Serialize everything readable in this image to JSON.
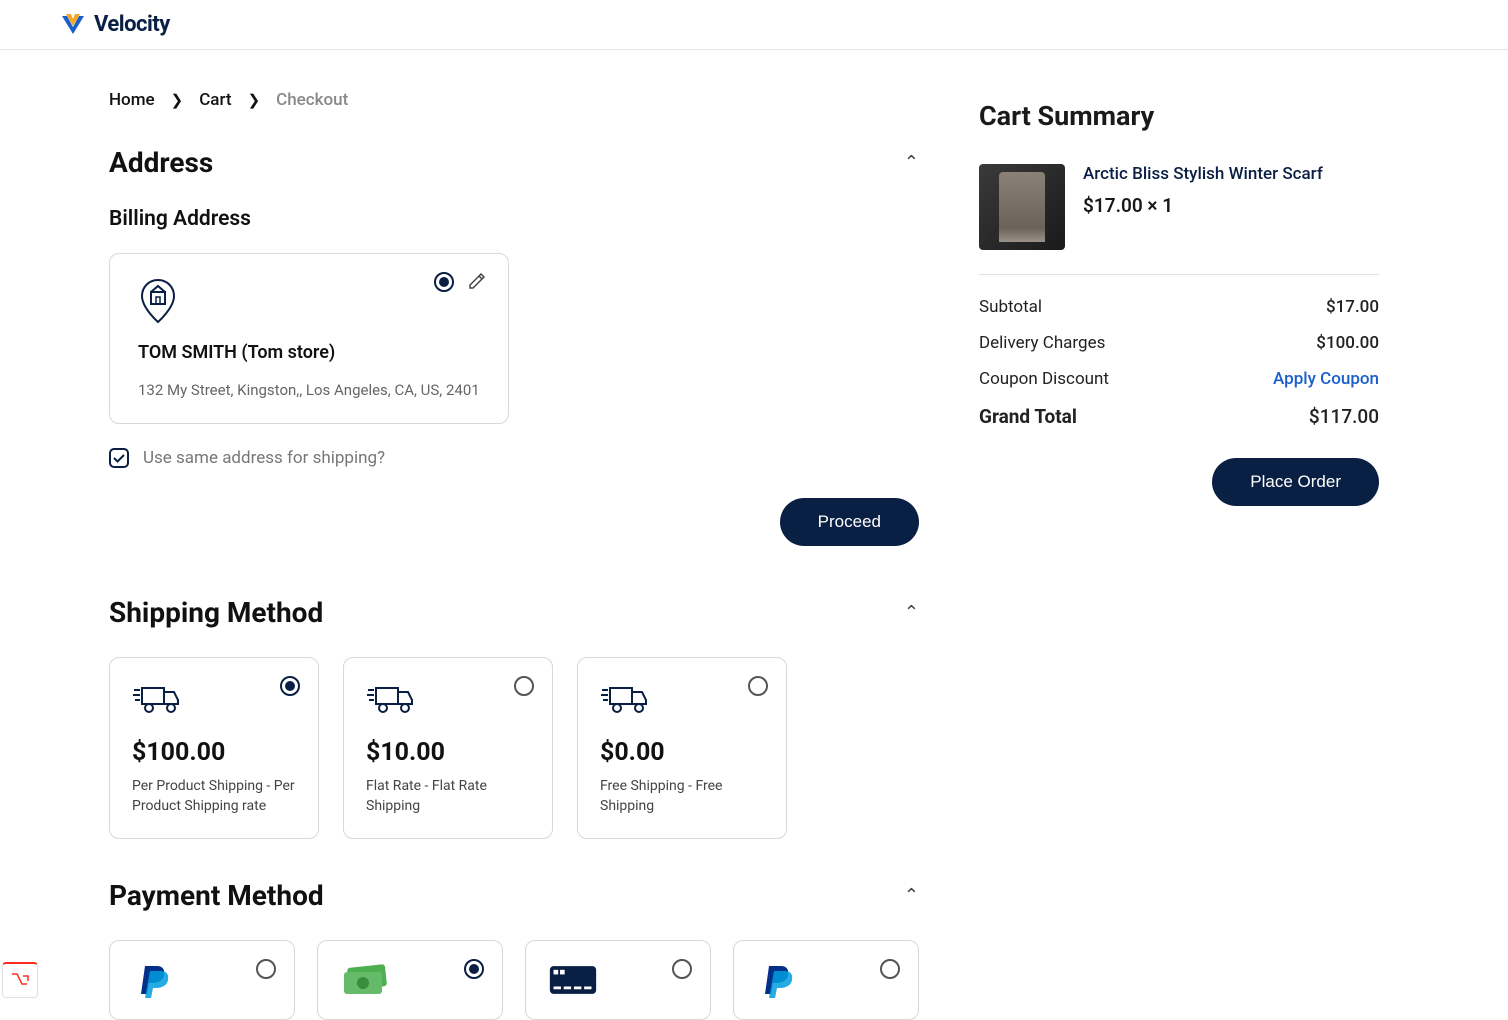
{
  "brand": {
    "name": "Velocity"
  },
  "breadcrumb": {
    "home": "Home",
    "cart": "Cart",
    "checkout": "Checkout"
  },
  "address": {
    "section_title": "Address",
    "billing_title": "Billing Address",
    "name": "TOM SMITH (Tom store)",
    "line": "132 My Street, Kingston,, Los Angeles, CA, US, 2401",
    "same_shipping_label": "Use same address for shipping?",
    "proceed_label": "Proceed"
  },
  "shipping": {
    "section_title": "Shipping Method",
    "options": [
      {
        "price": "$100.00",
        "desc": "Per Product Shipping - Per Product Shipping rate",
        "selected": true
      },
      {
        "price": "$10.00",
        "desc": "Flat Rate - Flat Rate Shipping",
        "selected": false
      },
      {
        "price": "$0.00",
        "desc": "Free Shipping - Free Shipping",
        "selected": false
      }
    ]
  },
  "payment": {
    "section_title": "Payment Method",
    "options": [
      {
        "icon": "paypal",
        "selected": false
      },
      {
        "icon": "cash",
        "selected": true
      },
      {
        "icon": "card",
        "selected": false
      },
      {
        "icon": "paypal",
        "selected": false
      }
    ]
  },
  "cart": {
    "title": "Cart Summary",
    "item": {
      "name": "Arctic Bliss Stylish Winter Scarf",
      "price_line": "$17.00 × 1"
    },
    "subtotal_label": "Subtotal",
    "subtotal_val": "$17.00",
    "delivery_label": "Delivery Charges",
    "delivery_val": "$100.00",
    "coupon_label": "Coupon Discount",
    "coupon_action": "Apply Coupon",
    "total_label": "Grand Total",
    "total_val": "$117.00",
    "place_order_label": "Place Order"
  }
}
